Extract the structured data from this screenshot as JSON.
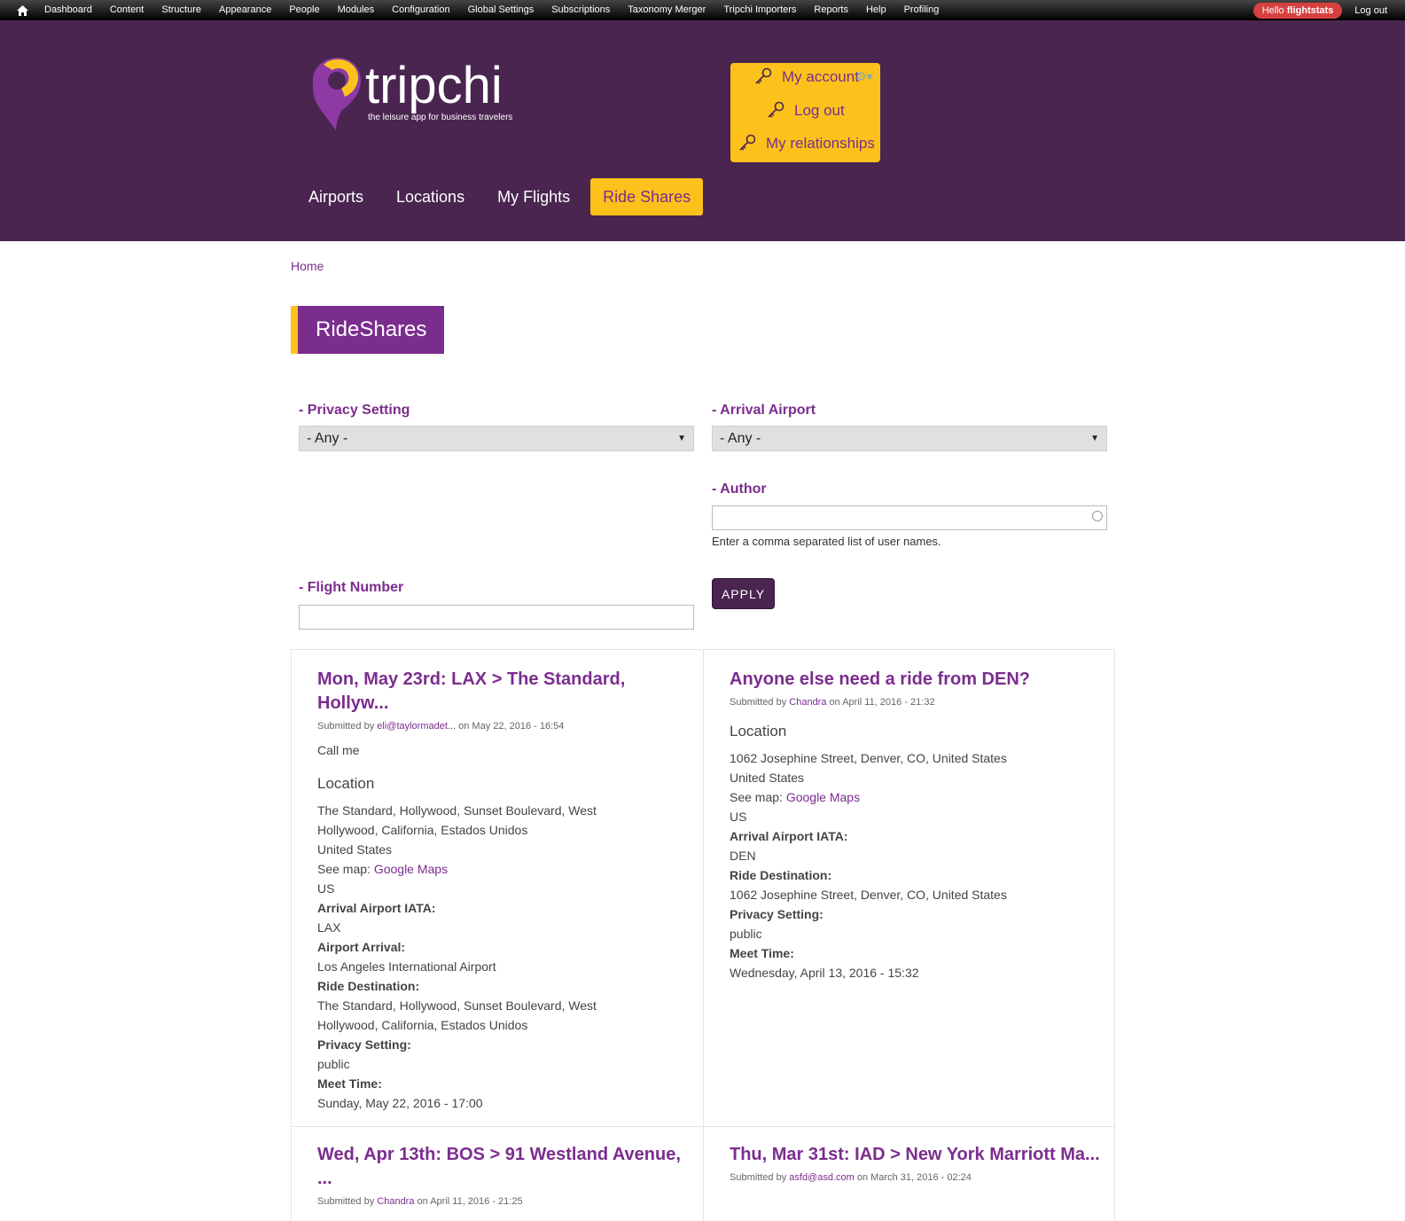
{
  "admin_bar": {
    "items": [
      "Dashboard",
      "Content",
      "Structure",
      "Appearance",
      "People",
      "Modules",
      "Configuration",
      "Global Settings",
      "Subscriptions",
      "Taxonomy Merger",
      "Tripchi Importers",
      "Reports",
      "Help",
      "Profiling"
    ],
    "hello_prefix": "Hello ",
    "username": "flightstats",
    "logout": "Log out"
  },
  "brand": {
    "name": "tripchi",
    "tagline": "the leisure app for business travelers"
  },
  "user_menu": {
    "items": [
      "My account",
      "Log out",
      "My relationships"
    ]
  },
  "main_nav": {
    "tabs": [
      "Airports",
      "Locations",
      "My Flights",
      "Ride Shares"
    ],
    "active": "Ride Shares"
  },
  "breadcrumb": "Home",
  "page_title": "RideShares",
  "filters": {
    "privacy_label": "- Privacy Setting",
    "privacy_value": "- Any -",
    "arrival_label": "- Arrival Airport",
    "arrival_value": "- Any -",
    "author_label": "- Author",
    "author_value": "",
    "author_help": "Enter a comma separated list of user names.",
    "flight_label": "- Flight Number",
    "flight_value": "",
    "apply": "APPLY"
  },
  "cards": [
    {
      "title": "Mon, May 23rd: LAX > The Standard, Hollyw...",
      "submitted_prefix": "Submitted by ",
      "author": "eli@taylormadet...",
      "date": " on May 22, 2016 - 16:54",
      "note": "Call me",
      "location_heading": "Location",
      "address": "The Standard, Hollywood, Sunset Boulevard, West Hollywood, California, Estados Unidos",
      "country": "United States",
      "see_map": "See map: ",
      "map_link": "Google Maps",
      "country_code": "US",
      "iata_label": "Arrival Airport IATA:",
      "iata": "LAX",
      "airport_label": "Airport Arrival:",
      "airport": "Los Angeles International Airport",
      "dest_label": "Ride Destination:",
      "dest": "The Standard, Hollywood, Sunset Boulevard, West Hollywood, California, Estados Unidos",
      "privacy_label": "Privacy Setting:",
      "privacy": "public",
      "meet_label": "Meet Time:",
      "meet": "Sunday, May 22, 2016 - 17:00"
    },
    {
      "title": "Anyone else need a ride from DEN?",
      "submitted_prefix": "Submitted by ",
      "author": "Chandra",
      "date": " on April 11, 2016 - 21:32",
      "location_heading": "Location",
      "address": "1062 Josephine Street, Denver, CO, United States",
      "country": "United States",
      "see_map": "See map: ",
      "map_link": "Google Maps",
      "country_code": "US",
      "iata_label": "Arrival Airport IATA:",
      "iata": "DEN",
      "dest_label": "Ride Destination:",
      "dest": "1062 Josephine Street, Denver, CO, United States",
      "privacy_label": "Privacy Setting:",
      "privacy": "public",
      "meet_label": "Meet Time:",
      "meet": "Wednesday, April 13, 2016 - 15:32"
    },
    {
      "title": "Wed, Apr 13th: BOS > 91 Westland Avenue, ...",
      "submitted_prefix": "Submitted by ",
      "author": "Chandra",
      "date": " on April 11, 2016 - 21:25"
    },
    {
      "title": "Thu, Mar 31st: IAD > New York Marriott Ma...",
      "submitted_prefix": "Submitted by ",
      "author": "asfd@asd.com",
      "date": " on March 31, 2016 - 02:24"
    }
  ],
  "colors": {
    "header_bg": "#4a2550",
    "accent_yellow": "#fcc21b",
    "brand_purple": "#7b2d8e"
  }
}
